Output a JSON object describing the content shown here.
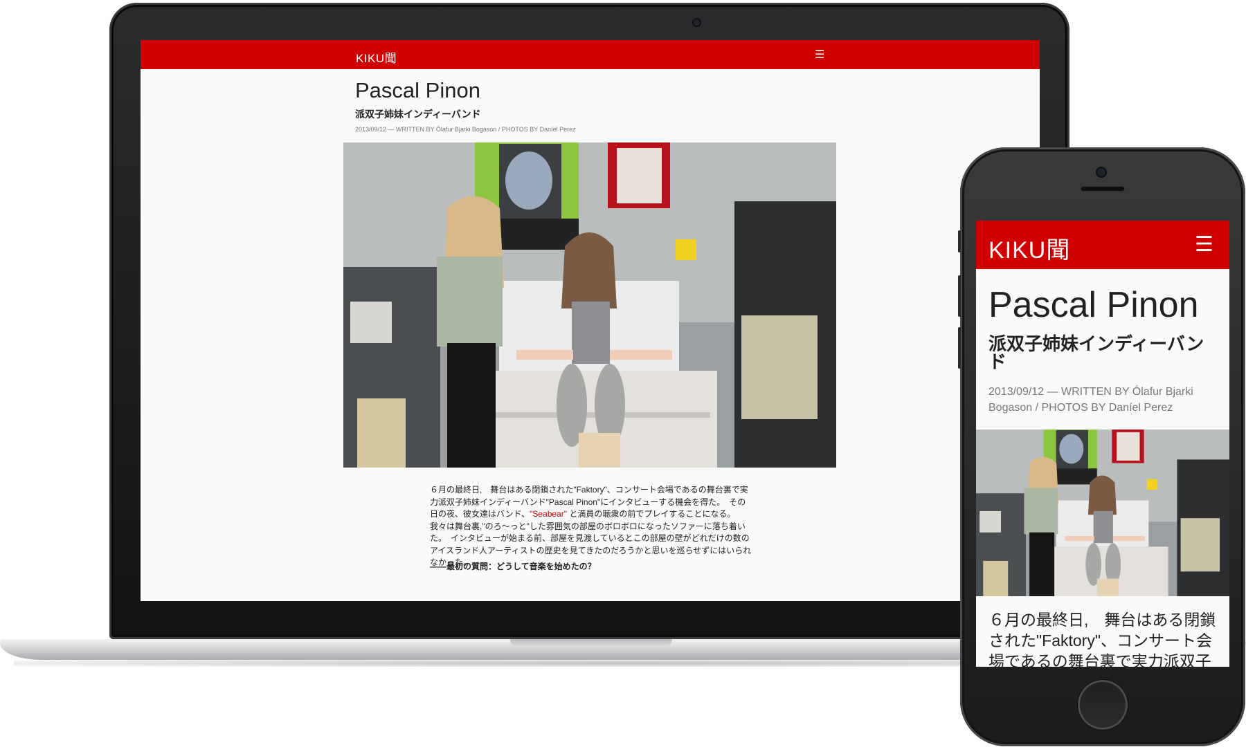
{
  "site": {
    "logo": "KIKU聞",
    "menu_icon": "hamburger-menu-icon"
  },
  "article": {
    "title": "Pascal Pinon",
    "subtitle": "派双子姉妹インディーバンド",
    "byline": "2013/09/12 — WRITTEN BY Ólafur Bjarki Bogason / PHOTOS BY Daníel Perez",
    "body_part1": "６月の最終日,　舞台はある閉鎖された\"Faktory\"、コンサート会場であるの舞台裏で実力派双子姉妹インディーバンド\"Pascal Pinon\"にインタビューする機会を得た。　その日の夜、彼女達はバンド、",
    "link_text": "\"Seabear\"",
    "body_part2": " と満員の聴衆の前でプレイすることになる。我々は舞台裏,\"のろ～っと\"した雰囲気の部屋のボロボロになったソファーに落ち着いた。　インタビューが始まる前、部屋を見渡しているとこの部屋の壁がどれだけの数のアイスランド人アーティストの歴史を見てきたのだろうかと思いを巡らせずにはいられなかった。",
    "question": "——最初の質問：どうして音楽を始めたの？",
    "mobile_body": "６月の最終日,　舞台はある閉鎖された\"Faktory\"、コンサート会場であるの舞台裏で実力派双子姉妹インディーバンド\"Pascal Pinon\"にインタビューする機会を得た。"
  },
  "colors": {
    "brand_red": "#d10000",
    "text": "#222222",
    "byline": "#777777",
    "link": "#c40000"
  }
}
